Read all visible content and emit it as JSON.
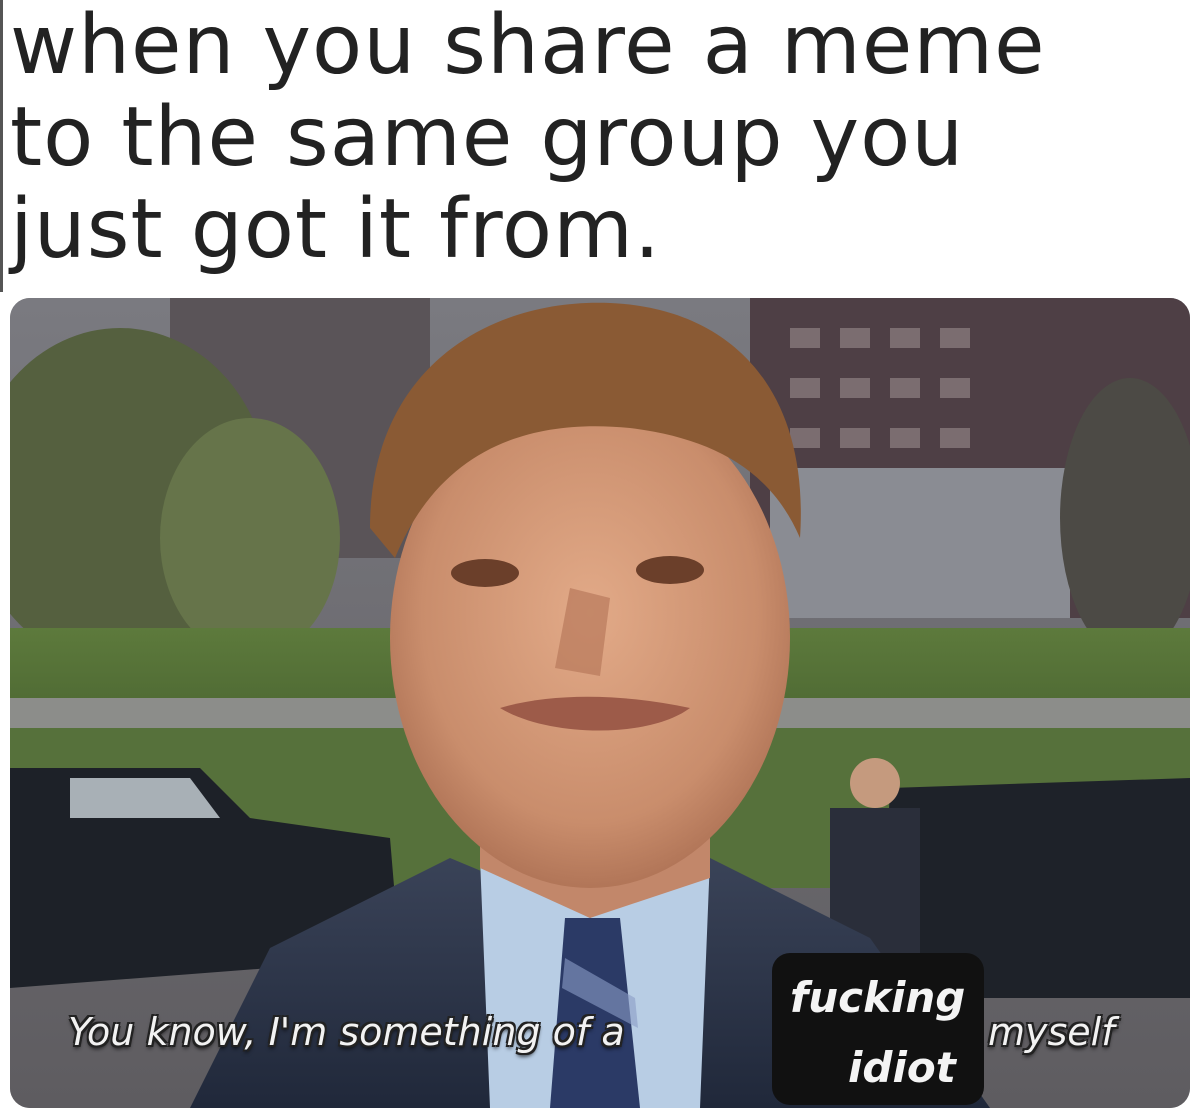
{
  "caption": {
    "line1": "when you share a meme",
    "line2": "to the same group you",
    "line3": "just got it from."
  },
  "subtitle": {
    "main": "You know, I'm something of a",
    "end": "myself"
  },
  "insert": {
    "word1": "fucking",
    "word2": "idiot"
  }
}
